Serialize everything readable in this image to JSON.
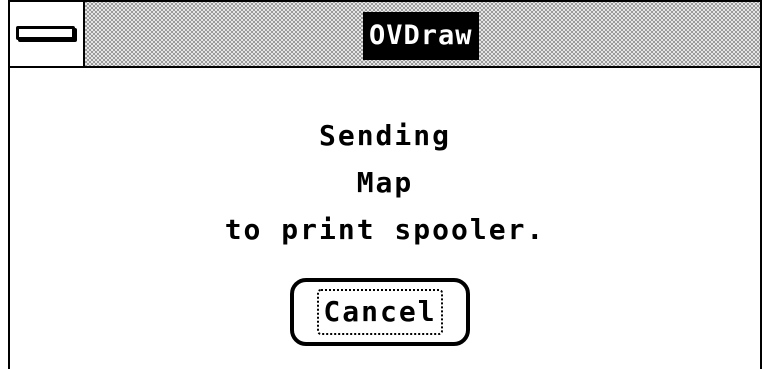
{
  "window": {
    "title": "OVDraw"
  },
  "message": {
    "lines": [
      "Sending",
      "Map",
      "to print spooler."
    ]
  },
  "buttons": {
    "cancel_label": "Cancel"
  },
  "icons": {
    "system_menu": "system-menu-icon"
  },
  "colors": {
    "title_background": "#000000",
    "title_text": "#ffffff",
    "window_background": "#ffffff"
  }
}
